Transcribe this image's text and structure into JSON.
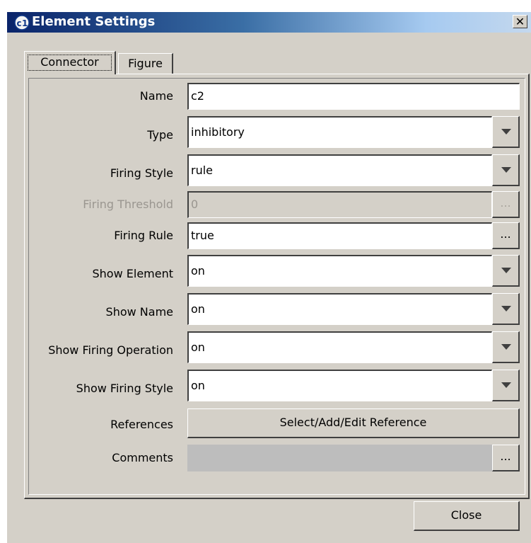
{
  "window": {
    "title": "Element Settings",
    "app_icon": "c1-app-icon",
    "close_glyph": "✕"
  },
  "tabs": [
    {
      "label": "Connector",
      "selected": true
    },
    {
      "label": "Figure",
      "selected": false
    }
  ],
  "form": {
    "name": {
      "label": "Name",
      "value": "c2"
    },
    "type": {
      "label": "Type",
      "value": "inhibitory"
    },
    "firing_style": {
      "label": "Firing Style",
      "value": "rule"
    },
    "firing_threshold": {
      "label": "Firing Threshold",
      "value": "0",
      "disabled": true,
      "button": "..."
    },
    "firing_rule": {
      "label": "Firing Rule",
      "value": "true",
      "button": "..."
    },
    "show_element": {
      "label": "Show Element",
      "value": "on"
    },
    "show_name": {
      "label": "Show Name",
      "value": "on"
    },
    "show_firing_operation": {
      "label": "Show Firing Operation",
      "value": "on"
    },
    "show_firing_style": {
      "label": "Show Firing Style",
      "value": "on"
    },
    "references": {
      "label": "References",
      "button": "Select/Add/Edit Reference"
    },
    "comments": {
      "label": "Comments",
      "value": "",
      "button": "..."
    }
  },
  "footer": {
    "close_label": "Close"
  },
  "colors": {
    "face": "#d4d0c8",
    "title_start": "#0a246a",
    "title_end": "#a6caf0",
    "disabled_text": "#9a9690"
  }
}
